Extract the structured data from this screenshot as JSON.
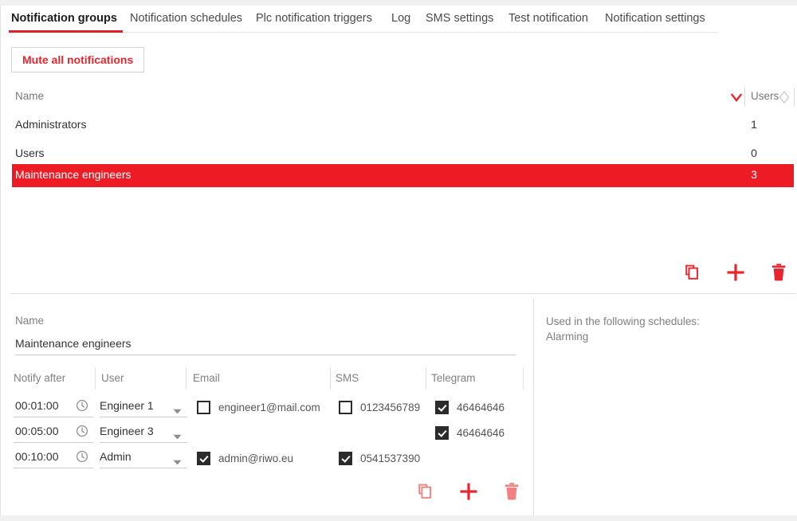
{
  "tabs": [
    {
      "label": "Notification groups",
      "active": true
    },
    {
      "label": "Notification schedules",
      "active": false
    },
    {
      "label": "Plc notification triggers",
      "active": false
    },
    {
      "label": "Log",
      "active": false
    },
    {
      "label": "SMS settings",
      "active": false
    },
    {
      "label": "Test notification",
      "active": false
    },
    {
      "label": "Notification settings",
      "active": false
    }
  ],
  "toolbar": {
    "mute_label": "Mute all notifications"
  },
  "groups_table": {
    "columns": {
      "name": "Name",
      "users": "Users"
    },
    "sort": {
      "column": "Name",
      "direction": "descending"
    },
    "rows": [
      {
        "name": "Administrators",
        "users": "1",
        "selected": false
      },
      {
        "name": "Users",
        "users": "0",
        "selected": false
      },
      {
        "name": "Maintenance engineers",
        "users": "3",
        "selected": true
      }
    ]
  },
  "group_actions": {
    "copy": "copy-icon",
    "add": "plus-icon",
    "delete": "trash-icon"
  },
  "detail": {
    "name_label": "Name",
    "name_value": "Maintenance engineers",
    "columns": [
      "Notify after",
      "User",
      "Email",
      "SMS",
      "Telegram"
    ],
    "rows": [
      {
        "notify_after": "00:01:00",
        "user": "Engineer 1",
        "email": {
          "checked": false,
          "value": "engineer1@mail.com",
          "present": true
        },
        "sms": {
          "checked": false,
          "value": "0123456789",
          "present": true
        },
        "telegram": {
          "checked": true,
          "value": "46464646",
          "present": true
        }
      },
      {
        "notify_after": "00:05:00",
        "user": "Engineer 3",
        "email": {
          "checked": false,
          "value": "",
          "present": false
        },
        "sms": {
          "checked": false,
          "value": "",
          "present": false
        },
        "telegram": {
          "checked": true,
          "value": "46464646",
          "present": true
        }
      },
      {
        "notify_after": "00:10:00",
        "user": "Admin",
        "email": {
          "checked": true,
          "value": "admin@riwo.eu",
          "present": true
        },
        "sms": {
          "checked": true,
          "value": "0541537390",
          "present": true
        },
        "telegram": {
          "checked": false,
          "value": "",
          "present": false
        }
      }
    ],
    "actions": {
      "copy": "copy-icon",
      "add": "plus-icon",
      "delete": "trash-icon"
    }
  },
  "right_pane": {
    "heading": "Used in the following schedules:",
    "schedules": [
      "Alarming"
    ]
  },
  "colors": {
    "accent_red": "#e8262d",
    "selection_red": "#ed1c24",
    "icon_red": "#e8262d",
    "icon_red_muted": "#f2827f"
  }
}
